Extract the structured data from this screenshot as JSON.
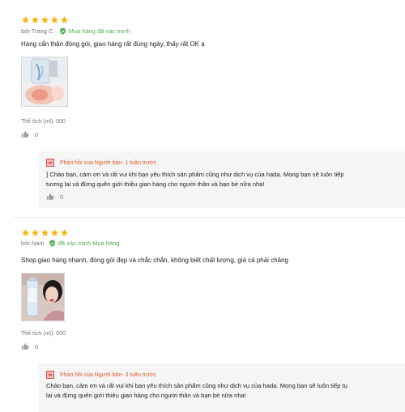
{
  "colors": {
    "star": "#f5b50a",
    "verified": "#4caf50",
    "seller_reply": "#e25c2c",
    "reply_bg": "#f5f5f5"
  },
  "reviews": [
    {
      "rating": 5,
      "author": "bởi Trang C.",
      "verified_label": "Mua hàng đã xác minh",
      "content": "Hàng cẩn thận đóng gói, giao hàng rất đúng ngày, thấy rất OK ạ",
      "attribute": "Thể tích (ml): 500",
      "likes": "0",
      "reply": {
        "who": "Phản hồi của Người bán",
        "time": " - 1 tuần trước",
        "line1": "] Chào bạn, cảm ơn và rất vui khi bạn yêu thích sản phẩm cũng như dịch vụ của hada.  Mong bạn sẽ luôn tiếp",
        "line2": "tương lai và đừng quên giới thiệu gian hàng cho người thân và bạn bè nữa nha!",
        "likes": "0"
      }
    },
    {
      "rating": 5,
      "author": "bởi Nam",
      "verified_label": "đã xác minh Mua hàng",
      "content": "Shop giao hàng nhanh, đóng gói đẹp và chắc chắn, không biết chất lượng, giá cả phải chăng",
      "attribute": "Thể tích (ml): 500",
      "likes": "0",
      "reply": {
        "who": "Phản hồi của Người bán",
        "time": " - 3 tuần trước",
        "line1": "Chào bạn, cảm ơn và rất vui khi bạn yêu thích sản phẩm cũng như dịch vụ của hada.  Mong bạn sẽ luôn tiếp tụ",
        "line2": "lai và đừng quên giới thiệu gian hàng cho người thân và bạn bè nữa nha!",
        "likes": ""
      }
    }
  ]
}
